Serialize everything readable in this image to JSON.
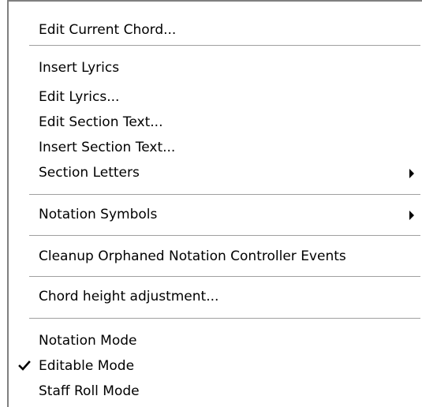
{
  "menu": {
    "groups": [
      {
        "items": [
          {
            "label": "Edit Current Chord..."
          }
        ]
      },
      {
        "items": [
          {
            "label": "Insert Lyrics"
          },
          {
            "label": "Edit Lyrics..."
          },
          {
            "label": "Edit Section Text..."
          },
          {
            "label": "Insert Section Text..."
          },
          {
            "label": "Section Letters",
            "submenu": true
          }
        ]
      },
      {
        "items": [
          {
            "label": "Notation Symbols",
            "submenu": true
          }
        ]
      },
      {
        "items": [
          {
            "label": "Cleanup Orphaned Notation Controller Events"
          }
        ]
      },
      {
        "items": [
          {
            "label": "Chord height adjustment..."
          }
        ]
      },
      {
        "items": [
          {
            "label": "Notation Mode"
          },
          {
            "label": "Editable Mode",
            "checked": true
          },
          {
            "label": "Staff Roll Mode"
          }
        ]
      }
    ]
  },
  "icons": {
    "submenu": "submenu-arrow-icon",
    "check": "checkmark-icon"
  },
  "colors": {
    "menu_background": "#ffffff",
    "text": "#000000",
    "separator": "#a0a0a0",
    "frame_shadow": "#808080"
  }
}
